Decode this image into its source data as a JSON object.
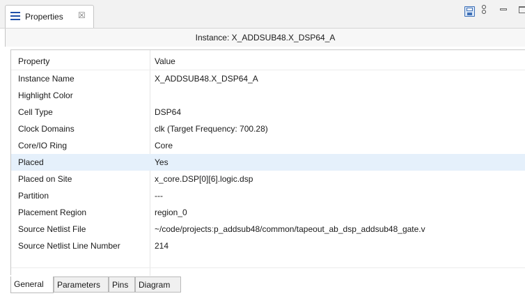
{
  "view": {
    "tab_title": "Properties",
    "tab_close_glyph": "☒"
  },
  "toolbar": {
    "icons": [
      "save-icon",
      "pin-icon",
      "minimize-icon",
      "maximize-icon"
    ]
  },
  "instance": {
    "title": "Instance: X_ADDSUB48.X_DSP64_A"
  },
  "table": {
    "headers": {
      "property": "Property",
      "value": "Value"
    },
    "rows": [
      {
        "property": "Instance Name",
        "value": "X_ADDSUB48.X_DSP64_A"
      },
      {
        "property": "Highlight Color",
        "value": ""
      },
      {
        "property": "Cell Type",
        "value": "DSP64"
      },
      {
        "property": "Clock Domains",
        "value": "clk (Target Frequency: 700.28)"
      },
      {
        "property": "Core/IO Ring",
        "value": "Core"
      },
      {
        "property": "Placed",
        "value": "Yes"
      },
      {
        "property": "Placed on Site",
        "value": "x_core.DSP[0][6].logic.dsp"
      },
      {
        "property": "Partition",
        "value": "---"
      },
      {
        "property": "Placement Region",
        "value": "region_0"
      },
      {
        "property": "Source Netlist File",
        "value": "~/code/projectsːp_addsub48/common/tapeout_ab_dsp_addsub48_gate.v"
      },
      {
        "property": "Source Netlist Line Number",
        "value": "214"
      }
    ],
    "selected_row": "Placed"
  },
  "bottom_tabs": [
    "General",
    "Parameters",
    "Pins",
    "Diagram"
  ],
  "active_bottom_tab": "General",
  "colors": {
    "selection": "#e5f0fb",
    "accent": "#1f4fa8"
  }
}
